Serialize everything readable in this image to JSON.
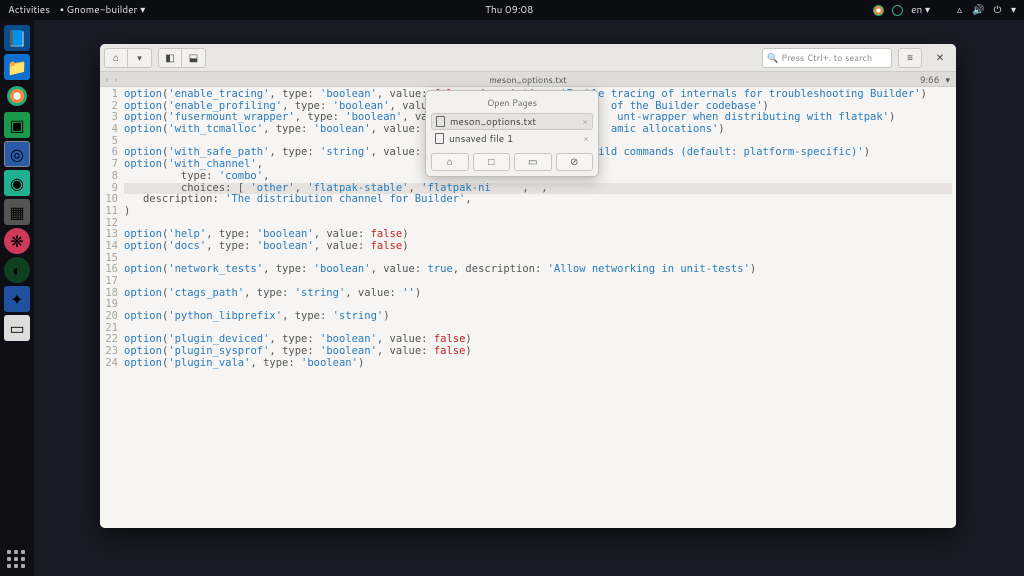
{
  "topbar": {
    "activities": "Activities",
    "app_menu": "Gnome-builder",
    "clock": "Thu 09:08",
    "lang": "en"
  },
  "window": {
    "search_placeholder": "Press Ctrl+. to search",
    "tab_title": "meson_options.txt",
    "cursor_pos": "9:66"
  },
  "popup": {
    "title": "Open Pages",
    "items": [
      "meson_options.txt",
      "unsaved file 1"
    ]
  },
  "code": {
    "lines": [
      {
        "n": 1,
        "t": [
          [
            "fn",
            "option"
          ],
          [
            "p",
            "("
          ],
          [
            "str",
            "'enable_tracing'"
          ],
          [
            "p",
            ", type: "
          ],
          [
            "str",
            "'boolean'"
          ],
          [
            "p",
            ", value: "
          ],
          [
            "bf",
            "false"
          ],
          [
            "p",
            ", description: "
          ],
          [
            "str",
            "'Enable tracing of internals for troubleshooting Builder'"
          ],
          [
            "p",
            ")"
          ]
        ]
      },
      {
        "n": 2,
        "t": [
          [
            "fn",
            "option"
          ],
          [
            "p",
            "("
          ],
          [
            "str",
            "'enable_profiling'"
          ],
          [
            "p",
            ", type: "
          ],
          [
            "str",
            "'boolean'"
          ],
          [
            "p",
            ", value: "
          ],
          [
            "bf",
            "fals"
          ],
          [
            "p",
            "                      "
          ],
          [
            "str",
            "of the Builder codebase'"
          ],
          [
            "p",
            ")"
          ]
        ]
      },
      {
        "n": 3,
        "t": [
          [
            "fn",
            "option"
          ],
          [
            "p",
            "("
          ],
          [
            "str",
            "'fusermount_wrapper'"
          ],
          [
            "p",
            ", type: "
          ],
          [
            "str",
            "'boolean'"
          ],
          [
            "p",
            ", value: "
          ],
          [
            "bf",
            "fa"
          ],
          [
            "p",
            "                       "
          ],
          [
            "str",
            "unt-wrapper when distributing with flatpak'"
          ],
          [
            "p",
            ")"
          ]
        ]
      },
      {
        "n": 4,
        "t": [
          [
            "fn",
            "option"
          ],
          [
            "p",
            "("
          ],
          [
            "str",
            "'with_tcmalloc'"
          ],
          [
            "p",
            ", type: "
          ],
          [
            "str",
            "'boolean'"
          ],
          [
            "p",
            ", value: "
          ],
          [
            "bf",
            "false"
          ],
          [
            "p",
            ",                       "
          ],
          [
            "str",
            "amic allocations'"
          ],
          [
            "p",
            ")"
          ]
        ]
      },
      {
        "n": 5,
        "t": []
      },
      {
        "n": 6,
        "t": [
          [
            "fn",
            "option"
          ],
          [
            "p",
            "("
          ],
          [
            "str",
            "'with_safe_path'"
          ],
          [
            "p",
            ", type: "
          ],
          [
            "str",
            "'string'"
          ],
          [
            "p",
            ", value: "
          ],
          [
            "str",
            "''"
          ],
          [
            "p",
            ", des                    "
          ],
          [
            "str",
            "ild commands (default: platform-specific)'"
          ],
          [
            "p",
            ")"
          ]
        ]
      },
      {
        "n": 7,
        "t": [
          [
            "fn",
            "option"
          ],
          [
            "p",
            "("
          ],
          [
            "str",
            "'with_channel'"
          ],
          [
            "p",
            ","
          ]
        ]
      },
      {
        "n": 8,
        "t": [
          [
            "p",
            "         type: "
          ],
          [
            "str",
            "'combo'"
          ],
          [
            "p",
            ","
          ]
        ]
      },
      {
        "n": 9,
        "t": [
          [
            "p",
            "         choices: [ "
          ],
          [
            "str",
            "'other'"
          ],
          [
            "p",
            ", "
          ],
          [
            "str",
            "'flatpak-stable'"
          ],
          [
            "p",
            ", "
          ],
          [
            "str",
            "'flatpak-ni"
          ],
          [
            "p",
            "     ,  ,"
          ]
        ],
        "cur": true
      },
      {
        "n": 10,
        "t": [
          [
            "p",
            "   description: "
          ],
          [
            "str",
            "'The distribution channel for Builder'"
          ],
          [
            "p",
            ","
          ]
        ]
      },
      {
        "n": 11,
        "t": [
          [
            "p",
            ")"
          ]
        ]
      },
      {
        "n": 12,
        "t": []
      },
      {
        "n": 13,
        "t": [
          [
            "fn",
            "option"
          ],
          [
            "p",
            "("
          ],
          [
            "str",
            "'help'"
          ],
          [
            "p",
            ", type: "
          ],
          [
            "str",
            "'boolean'"
          ],
          [
            "p",
            ", value: "
          ],
          [
            "bf",
            "false"
          ],
          [
            "p",
            ")"
          ]
        ]
      },
      {
        "n": 14,
        "t": [
          [
            "fn",
            "option"
          ],
          [
            "p",
            "("
          ],
          [
            "str",
            "'docs'"
          ],
          [
            "p",
            ", type: "
          ],
          [
            "str",
            "'boolean'"
          ],
          [
            "p",
            ", value: "
          ],
          [
            "bf",
            "false"
          ],
          [
            "p",
            ")"
          ]
        ]
      },
      {
        "n": 15,
        "t": []
      },
      {
        "n": 16,
        "t": [
          [
            "fn",
            "option"
          ],
          [
            "p",
            "("
          ],
          [
            "str",
            "'network_tests'"
          ],
          [
            "p",
            ", type: "
          ],
          [
            "str",
            "'boolean'"
          ],
          [
            "p",
            ", value: "
          ],
          [
            "bt",
            "true"
          ],
          [
            "p",
            ", description: "
          ],
          [
            "str",
            "'Allow networking in unit-tests'"
          ],
          [
            "p",
            ")"
          ]
        ]
      },
      {
        "n": 17,
        "t": []
      },
      {
        "n": 18,
        "t": [
          [
            "fn",
            "option"
          ],
          [
            "p",
            "("
          ],
          [
            "str",
            "'ctags_path'"
          ],
          [
            "p",
            ", type: "
          ],
          [
            "str",
            "'string'"
          ],
          [
            "p",
            ", value: "
          ],
          [
            "str",
            "''"
          ],
          [
            "p",
            ")"
          ]
        ]
      },
      {
        "n": 19,
        "t": []
      },
      {
        "n": 20,
        "t": [
          [
            "fn",
            "option"
          ],
          [
            "p",
            "("
          ],
          [
            "str",
            "'python_libprefix'"
          ],
          [
            "p",
            ", type: "
          ],
          [
            "str",
            "'string'"
          ],
          [
            "p",
            ")"
          ]
        ]
      },
      {
        "n": 21,
        "t": []
      },
      {
        "n": 22,
        "t": [
          [
            "fn",
            "option"
          ],
          [
            "p",
            "("
          ],
          [
            "str",
            "'plugin_deviced'"
          ],
          [
            "p",
            ", type: "
          ],
          [
            "str",
            "'boolean'"
          ],
          [
            "p",
            ", value: "
          ],
          [
            "bf",
            "false"
          ],
          [
            "p",
            ")"
          ]
        ]
      },
      {
        "n": 23,
        "t": [
          [
            "fn",
            "option"
          ],
          [
            "p",
            "("
          ],
          [
            "str",
            "'plugin_sysprof'"
          ],
          [
            "p",
            ", type: "
          ],
          [
            "str",
            "'boolean'"
          ],
          [
            "p",
            ", value: "
          ],
          [
            "bf",
            "false"
          ],
          [
            "p",
            ")"
          ]
        ]
      },
      {
        "n": 24,
        "t": [
          [
            "fn",
            "option"
          ],
          [
            "p",
            "("
          ],
          [
            "str",
            "'plugin_vala'"
          ],
          [
            "p",
            ", type: "
          ],
          [
            "str",
            "'boolean'"
          ],
          [
            "p",
            ")"
          ]
        ]
      }
    ]
  },
  "dock_colors": [
    "#0a4b8a",
    "#1070d0",
    "#ffffff",
    "#1a9a4a",
    "#d0d0d0",
    "#20b090",
    "#606060",
    "#d03a5a",
    "#20a050",
    "#2050a0",
    "#c0c0c0"
  ]
}
